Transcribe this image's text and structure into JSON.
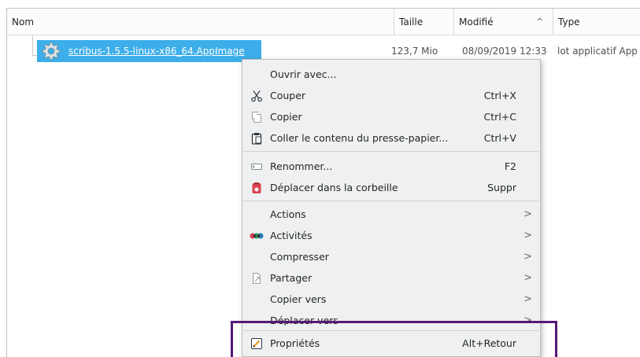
{
  "columns": {
    "name": "Nom",
    "size": "Taille",
    "modified": "Modifié",
    "sort_indicator": "^",
    "type": "Type"
  },
  "file": {
    "name": "scribus-1.5.5-linux-x86_64.AppImage",
    "size": "123,7 Mio",
    "modified": "08/09/2019 12:33",
    "type": "lot applicatif App"
  },
  "menu": {
    "open_with": "Ouvrir avec...",
    "cut": "Couper",
    "cut_sc": "Ctrl+X",
    "copy": "Copier",
    "copy_sc": "Ctrl+C",
    "paste": "Coller le contenu du presse-papier...",
    "paste_sc": "Ctrl+V",
    "rename": "Renommer...",
    "rename_sc": "F2",
    "trash": "Déplacer dans la corbeille",
    "trash_sc": "Suppr",
    "actions": "Actions",
    "activities": "Activités",
    "compress": "Compresser",
    "share": "Partager",
    "copy_to": "Copier vers",
    "move_to": "Déplacer vers",
    "properties": "Propriétés",
    "properties_sc": "Alt+Retour",
    "submenu_arrow": ">"
  },
  "colors": {
    "selection": "#3daee9",
    "menu_bg": "#eff0f1",
    "highlight_box": "#531a78",
    "trash_icon": "#da4453"
  }
}
